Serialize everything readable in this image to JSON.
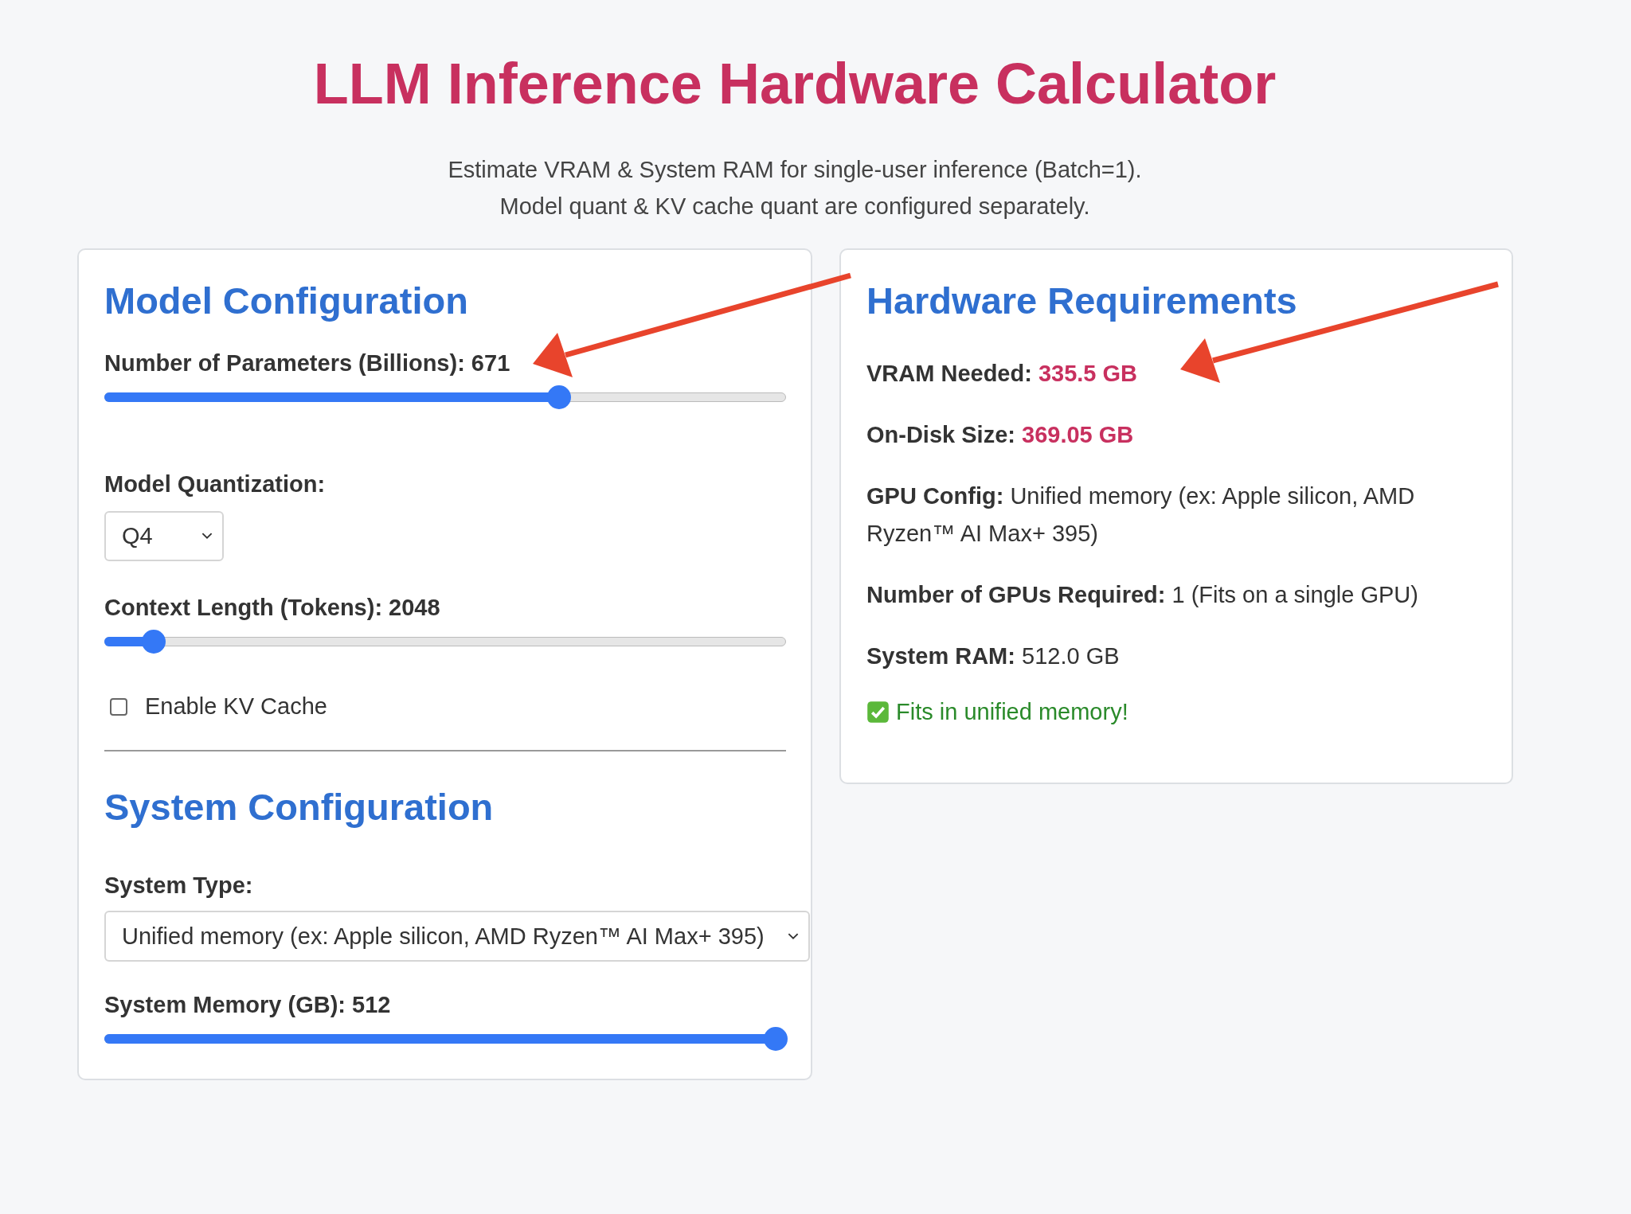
{
  "title": "LLM Inference Hardware Calculator",
  "subtitle_lines": [
    "Estimate VRAM & System RAM for single-user inference (Batch=1).",
    "Model quant & KV cache quant are configured separately."
  ],
  "model_config": {
    "heading": "Model Configuration",
    "params": {
      "label": "Number of Parameters (Billions): 671",
      "level": 0.667
    },
    "quantization": {
      "label": "Model Quantization:",
      "value": "Q4"
    },
    "context": {
      "label": "Context Length (Tokens): 2048",
      "level": 0.073
    },
    "kv_cache": {
      "label": "Enable KV Cache",
      "checked": false
    }
  },
  "system_config": {
    "heading": "System Configuration",
    "system_type": {
      "label": "System Type:",
      "value": "Unified memory (ex: Apple silicon, AMD Ryzen™ AI Max+ 395)"
    },
    "memory": {
      "label": "System Memory (GB): 512",
      "level": 0.985
    }
  },
  "hardware": {
    "heading": "Hardware Requirements",
    "rows": [
      {
        "label": "VRAM Needed:",
        "value": "335.5 GB",
        "kind": "highlight"
      },
      {
        "label": "On-Disk Size:",
        "value": "369.05 GB",
        "kind": "highlight"
      },
      {
        "label": "GPU Config:",
        "value": "Unified memory (ex: Apple silicon, AMD Ryzen™ AI Max+ 395)",
        "kind": "plain"
      },
      {
        "label": "Number of GPUs Required:",
        "value": "1 (Fits on a single GPU)",
        "kind": "plain"
      },
      {
        "label": "System RAM:",
        "value": "512.0 GB",
        "kind": "plain"
      }
    ],
    "status": {
      "text": "Fits in unified memory!",
      "ok": true
    }
  }
}
